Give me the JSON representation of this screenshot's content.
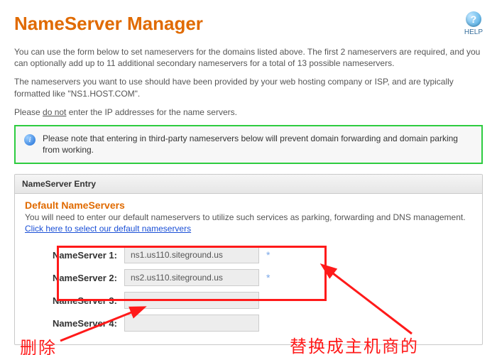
{
  "header": {
    "title": "NameServer Manager",
    "help_label": "HELP"
  },
  "intro": {
    "p1": "You can use the form below to set nameservers for the domains listed above. The first 2 nameservers are required, and you can optionally add up to 11 additional secondary nameservers for a total of 13 possible nameservers.",
    "p2a": "The nameservers you want to use should have been provided by your web hosting company or ISP, and are typically formatted like ",
    "p2b": "\"NS1.HOST.COM\".",
    "p3a": "Please ",
    "p3b": "do not",
    "p3c": " enter the IP addresses for the name servers."
  },
  "notice": "Please note that entering in third-party nameservers below will prevent domain forwarding and domain parking from working.",
  "panel": {
    "head": "NameServer Entry",
    "section_title": "Default NameServers",
    "section_sub": "You will need to enter our default nameservers to utilize such services as parking, forwarding and DNS management.",
    "default_link": "Click here to select our default nameservers",
    "rows": [
      {
        "label": "NameServer 1:",
        "value": "ns1.us110.siteground.us",
        "required": "*"
      },
      {
        "label": "NameServer 2:",
        "value": "ns2.us110.siteground.us",
        "required": "*"
      },
      {
        "label": "NameServer 3:",
        "value": "",
        "required": ""
      },
      {
        "label": "NameServer 4:",
        "value": "",
        "required": ""
      }
    ]
  },
  "annotations": {
    "replace": "替换成主机商的",
    "delete": "删除"
  }
}
